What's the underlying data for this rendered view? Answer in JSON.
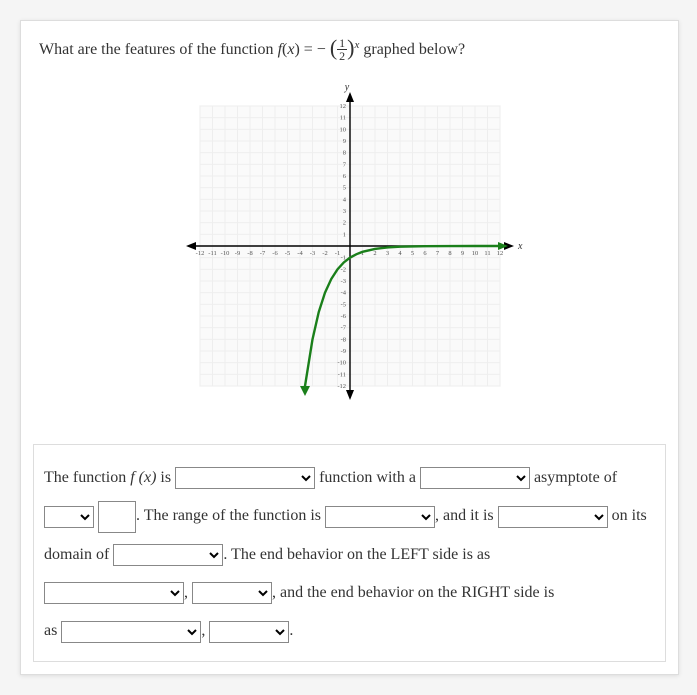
{
  "question": {
    "prefix": "What are the features of the function ",
    "func_letter": "f",
    "arg_letter": "x",
    "eq": " = − ",
    "frac_num": "1",
    "frac_den": "2",
    "exp": "x",
    "suffix": " graphed below?"
  },
  "chart_data": {
    "type": "line",
    "title": "",
    "xlabel": "x",
    "ylabel": "y",
    "xlim": [
      -12,
      12
    ],
    "ylim": [
      -12,
      12
    ],
    "xticks": [
      -12,
      -11,
      -10,
      -9,
      -8,
      -7,
      -6,
      -5,
      -4,
      -3,
      -2,
      -1,
      1,
      2,
      3,
      4,
      5,
      6,
      7,
      8,
      9,
      10,
      11,
      12
    ],
    "yticks": [
      -12,
      -11,
      -10,
      -9,
      -8,
      -7,
      -6,
      -5,
      -4,
      -3,
      -2,
      -1,
      1,
      2,
      3,
      4,
      5,
      6,
      7,
      8,
      9,
      10,
      11,
      12
    ],
    "series": [
      {
        "name": "f(x) = -(1/2)^x",
        "color": "#1a7f1a",
        "x": [
          -3.6,
          -3,
          -2.5,
          -2,
          -1.5,
          -1,
          -0.5,
          0,
          0.5,
          1,
          2,
          3,
          4,
          6,
          8,
          10,
          12
        ],
        "y": [
          -12.13,
          -8,
          -5.66,
          -4,
          -2.83,
          -2,
          -1.41,
          -1,
          -0.71,
          -0.5,
          -0.25,
          -0.125,
          -0.0625,
          -0.0156,
          -0.0039,
          -0.001,
          0
        ]
      }
    ],
    "asymptotes": [
      {
        "type": "horizontal",
        "y": 0
      }
    ]
  },
  "answer": {
    "t1": "The function ",
    "fx": "f (x)",
    "t2": " is ",
    "t3": " function with a ",
    "t4": " asymptote of",
    "t5": ". The range of the function is ",
    "t6": ", and it is ",
    "t7": " on its",
    "t8": "domain of ",
    "t9": ". The end behavior on the LEFT side is as",
    "t10": ", ",
    "t11": ", and the end behavior on the RIGHT side is",
    "t12": "as ",
    "t13": ", ",
    "t14": "."
  }
}
